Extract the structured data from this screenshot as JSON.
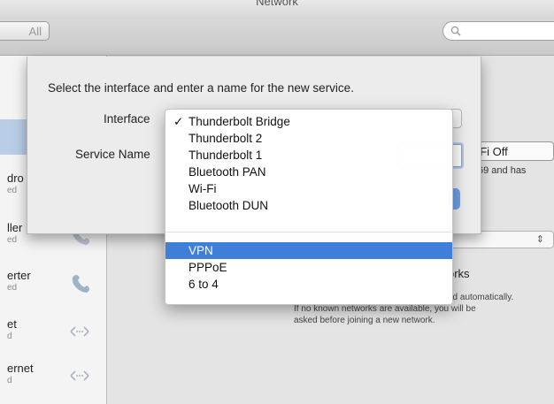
{
  "window": {
    "title": "Network"
  },
  "toolbar": {
    "show_all_label": "All",
    "search_placeholder": ""
  },
  "sidebar": {
    "services": [
      {
        "name": "dro",
        "status": "ed"
      },
      {
        "name": "ller",
        "status": "ed"
      },
      {
        "name": "erter",
        "status": "ed"
      },
      {
        "name": "et",
        "status": "d"
      },
      {
        "name": "ernet",
        "status": "d"
      }
    ]
  },
  "background": {
    "wifi_off_label": "i-Fi Off",
    "ip_fragment": "69 and has",
    "known_networks": "orks",
    "desc_line1": "ed automatically.",
    "desc_line2": "If no known networks are available, you will be",
    "desc_line3": "asked before joining a new network."
  },
  "sheet": {
    "prompt": "Select the interface and enter a name for the new service.",
    "interface_label": "Interface",
    "service_name_label": "Service Name"
  },
  "menu": {
    "checkmark": "✓",
    "items": [
      {
        "label": "Thunderbolt Bridge",
        "checked": true
      },
      {
        "label": "Thunderbolt 2"
      },
      {
        "label": "Thunderbolt 1"
      },
      {
        "label": "Bluetooth PAN"
      },
      {
        "label": "Wi-Fi"
      },
      {
        "label": "Bluetooth DUN"
      },
      {
        "label": "VPN",
        "highlighted": true
      },
      {
        "label": "PPPoE"
      },
      {
        "label": "6 to 4"
      }
    ]
  },
  "colors": {
    "highlight": "#3f7fd9",
    "selected_sidebar": "#b9cde6"
  }
}
